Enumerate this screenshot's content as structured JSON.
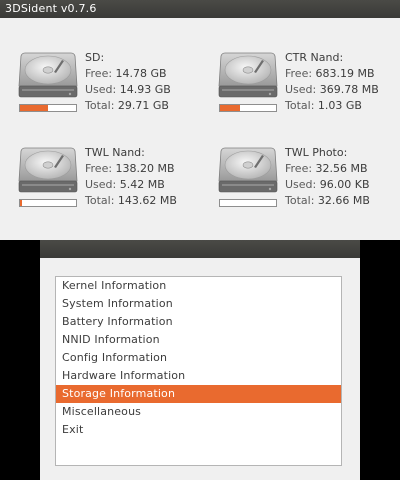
{
  "app": {
    "title": "3DSident v0.7.6"
  },
  "colors": {
    "accent": "#e96a2f",
    "title_bar": "#3f3f3c",
    "background": "#f0f0f0"
  },
  "storage": {
    "sd": {
      "name": "SD:",
      "free_label": "Free: ",
      "free": "14.78 GB",
      "used_label": "Used: ",
      "used": "14.93 GB",
      "total_label": "Total: ",
      "total": "29.71 GB",
      "used_fraction": 0.5,
      "icon": "hard-drive-icon"
    },
    "ctr_nand": {
      "name": "CTR Nand:",
      "free_label": "Free: ",
      "free": "683.19 MB",
      "used_label": "Used: ",
      "used": "369.78 MB",
      "total_label": "Total: ",
      "total": "1.03 GB",
      "used_fraction": 0.35,
      "icon": "hard-drive-icon"
    },
    "twl_nand": {
      "name": "TWL Nand:",
      "free_label": "Free: ",
      "free": "138.20 MB",
      "used_label": "Used: ",
      "used": "5.42 MB",
      "total_label": "Total: ",
      "total": "143.62 MB",
      "used_fraction": 0.04,
      "icon": "hard-drive-icon"
    },
    "twl_photo": {
      "name": "TWL Photo:",
      "free_label": "Free: ",
      "free": "32.56 MB",
      "used_label": "Used: ",
      "used": "96.00 KB",
      "total_label": "Total: ",
      "total": "32.66 MB",
      "used_fraction": 0.0,
      "icon": "hard-drive-icon"
    }
  },
  "menu": {
    "selected_index": 6,
    "items": [
      "Kernel Information",
      "System Information",
      "Battery Information",
      "NNID Information",
      "Config Information",
      "Hardware Information",
      "Storage Information",
      "Miscellaneous",
      "Exit"
    ]
  }
}
